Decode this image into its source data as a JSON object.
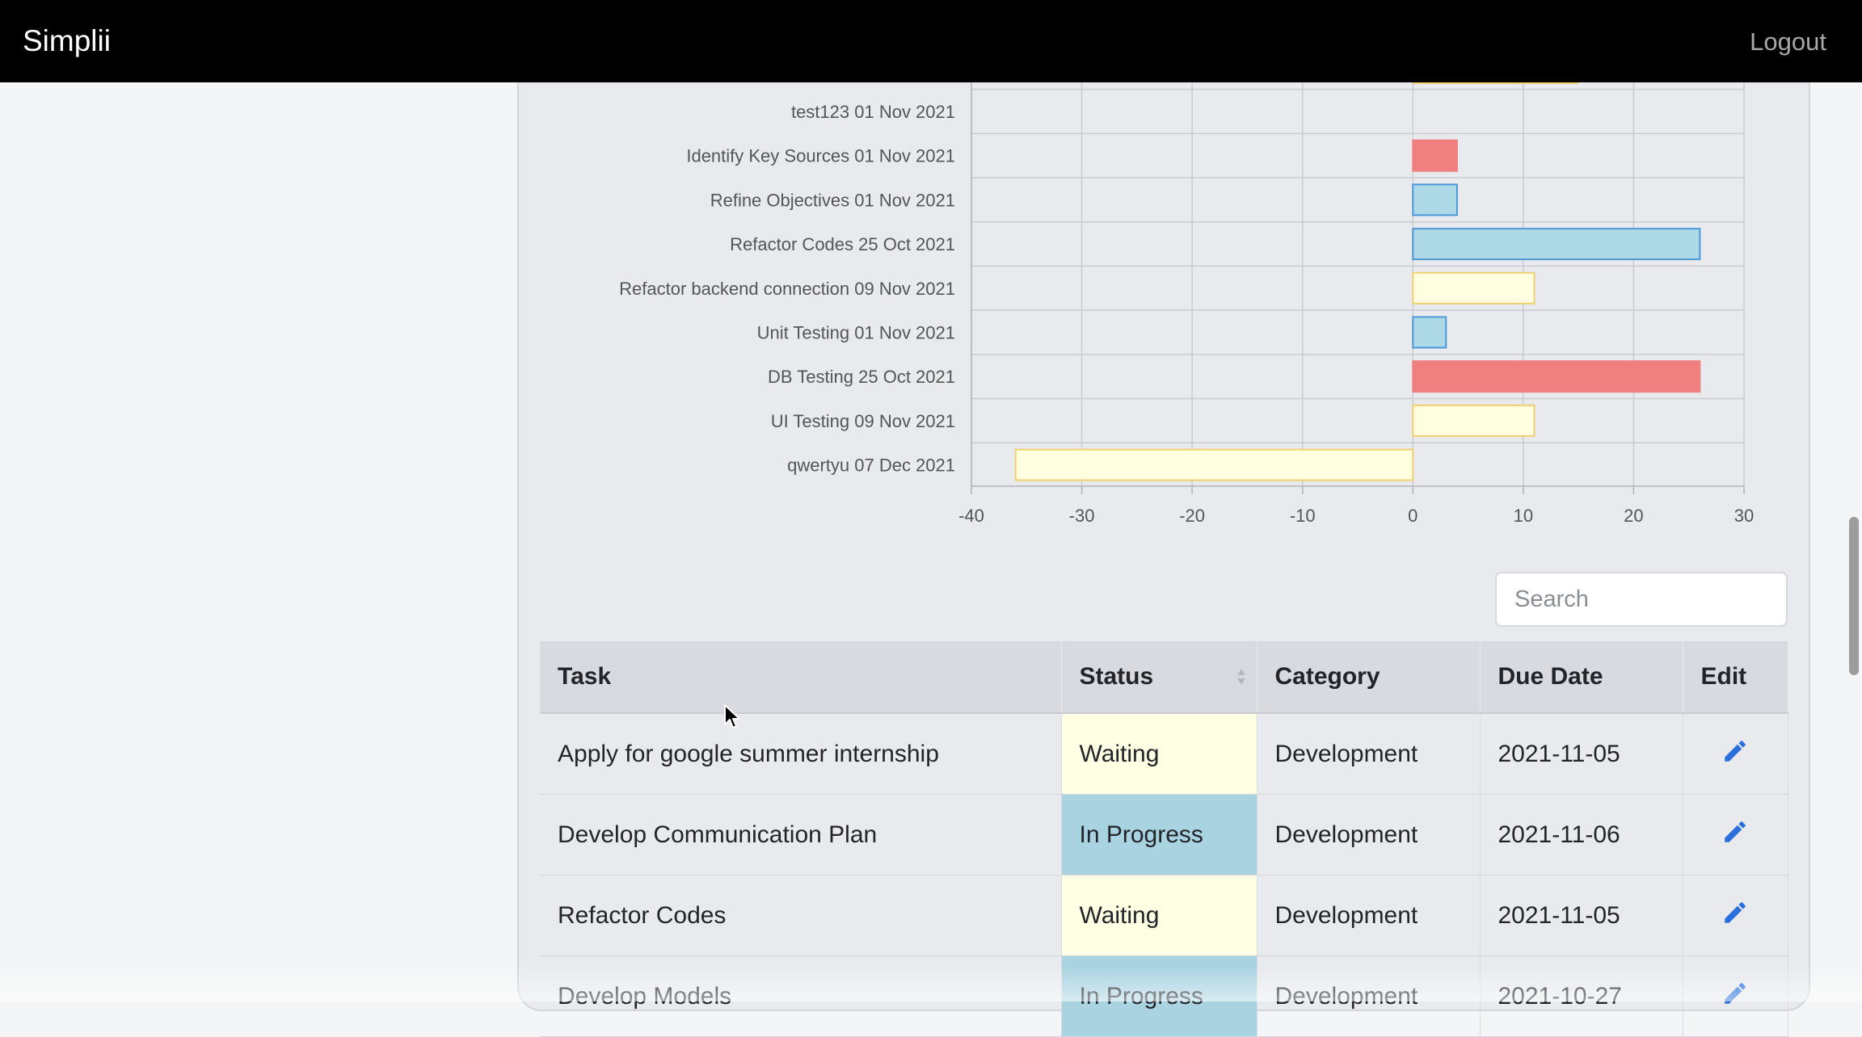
{
  "app": {
    "brand": "Simplii",
    "logout_label": "Logout"
  },
  "chart_data": {
    "type": "bar",
    "orientation": "horizontal",
    "categories": [
      "test123 01 Nov 2021",
      "Identify Key Sources 01 Nov 2021",
      "Refine Objectives 01 Nov 2021",
      "Refactor Codes 25 Oct 2021",
      "Refactor backend connection 09 Nov 2021",
      "Unit Testing 01 Nov 2021",
      "DB Testing 25 Oct 2021",
      "UI Testing 09 Nov 2021",
      "qwertyu 07 Dec 2021"
    ],
    "values": [
      0,
      4,
      4,
      26,
      11,
      3,
      26,
      11,
      -36
    ],
    "statuses": [
      "Waiting",
      "Done",
      "In Progress",
      "In Progress",
      "Waiting",
      "In Progress",
      "Done",
      "Waiting",
      "Waiting"
    ],
    "status_colors": {
      "Waiting": "#ffffe0",
      "In Progress": "#add8e6",
      "Done": "#f08080"
    },
    "status_border_colors": {
      "Waiting": "#f0d070",
      "In Progress": "#4a98d8",
      "Done": "#f08080"
    },
    "xlim": [
      -40,
      30
    ],
    "xticks": [
      -40,
      -30,
      -20,
      -10,
      0,
      10,
      20,
      30
    ],
    "grid": true
  },
  "search": {
    "placeholder": "Search"
  },
  "table": {
    "headers": {
      "task": "Task",
      "status": "Status",
      "category": "Category",
      "due": "Due Date",
      "edit": "Edit"
    },
    "rows": [
      {
        "task": "Apply for google summer internship",
        "status": "Waiting",
        "category": "Development",
        "due": "2021-11-05"
      },
      {
        "task": "Develop Communication Plan",
        "status": "In Progress",
        "category": "Development",
        "due": "2021-11-06"
      },
      {
        "task": "Refactor Codes",
        "status": "Waiting",
        "category": "Development",
        "due": "2021-11-05"
      },
      {
        "task": "Develop Models",
        "status": "In Progress",
        "category": "Development",
        "due": "2021-10-27"
      }
    ]
  },
  "icons": {
    "edit": "pencil-icon",
    "edit_color": "#2a6fdb"
  }
}
